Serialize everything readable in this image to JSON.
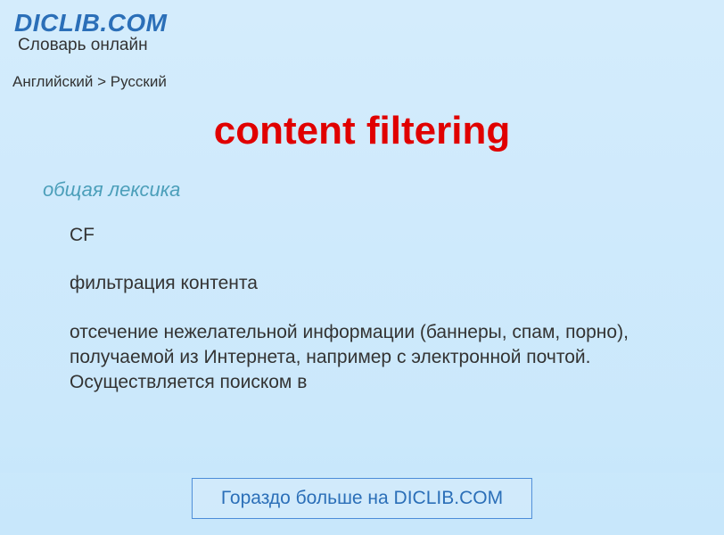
{
  "header": {
    "site_name": "DICLIB.COM",
    "tagline": "Словарь онлайн"
  },
  "breadcrumb": "Английский > Русский",
  "title": "content filtering",
  "category": "общая лексика",
  "definitions": [
    "CF",
    "фильтрация контента",
    "отсечение нежелательной информации (баннеры, спам, порно), получаемой из Интернета, например с электронной почтой. Осуществляется поиском в"
  ],
  "footer": {
    "link_text": "Гораздо больше на DICLIB.COM"
  }
}
